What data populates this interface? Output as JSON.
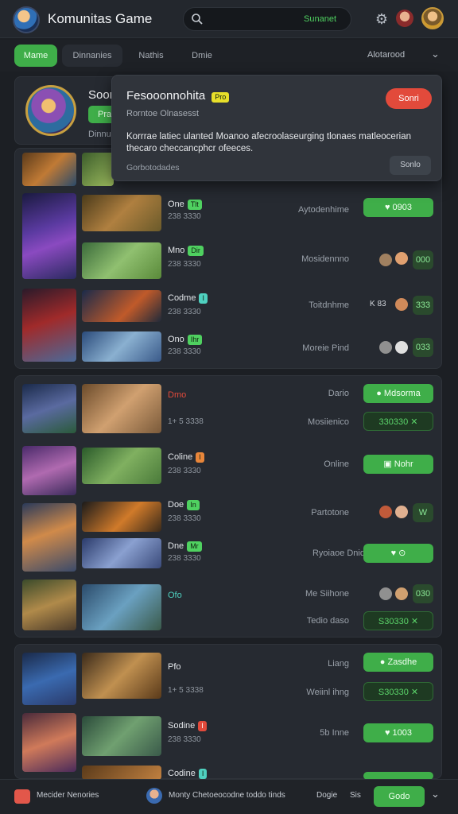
{
  "app": {
    "title": "Komunitas Game"
  },
  "search": {
    "value": "Sunanet"
  },
  "tabs": [
    {
      "label": "Mame",
      "active": true
    },
    {
      "label": "Dinnanies"
    },
    {
      "label": "Nathis"
    },
    {
      "label": "Dmie"
    }
  ],
  "sort": {
    "label": "Alotarood"
  },
  "profile": {
    "title": "Soor",
    "button": "Pra",
    "sub": "Dinnu"
  },
  "popup": {
    "title": "Fesooonnohita",
    "badge": "Pro",
    "subtitle": "Rorntoe Olnasesst",
    "description": "Korrrae latiec ulanted Moanoo afecroolaseurging tlonaes  matleocerian thecaro checcancphcr ofeeces.",
    "footer": "Gorbotodades",
    "primary": "Sonri",
    "secondary": "Sonlo"
  },
  "groups": [
    {
      "rows": [
        {
          "title": "One",
          "badge": "Tlt",
          "sub": "238 3330",
          "status": "Aytodenhime",
          "button": "0903",
          "style": "solid"
        },
        {
          "title": "Mno",
          "badge": "Dir",
          "sub": "238 3330",
          "status": "Mosidennno",
          "button": "000",
          "style": "small"
        },
        {
          "title": "Codme",
          "badge": "I",
          "sub": "238 3330",
          "status": "Toitdnhme",
          "button": "333",
          "style": "small",
          "extra": "K 83"
        },
        {
          "title": "Ono",
          "badge": "Ihr",
          "sub": "238 3330",
          "status": "Moreie Pind",
          "button": "033",
          "style": "small"
        }
      ]
    },
    {
      "rows": [
        {
          "title": "Dmo",
          "badge": "",
          "sub": "1+ 5 3338",
          "status": "Dario",
          "button": "Mdsorma",
          "style": "solid",
          "button2": "330330",
          "status2": "Mosiienico"
        },
        {
          "title": "Coline",
          "badge": "I",
          "sub": "238 3330",
          "status": "Online",
          "button": "Nohr",
          "style": "solid"
        },
        {
          "title": "Doe",
          "badge": "In",
          "sub": "238 3330",
          "status": "Partotone",
          "button": "W",
          "style": "small"
        },
        {
          "title": "Dne",
          "badge": "Mr",
          "sub": "238 3330",
          "status": "Ryoiaoe Dnid",
          "button": "0",
          "style": "solid"
        },
        {
          "title": "Ofo",
          "badge": "",
          "sub": "",
          "status": "Me Siihone",
          "button": "030",
          "style": "small",
          "button2": "S30330",
          "status2": "Tedio daso"
        }
      ]
    },
    {
      "rows": [
        {
          "title": "Pfo",
          "badge": "",
          "sub": "1+ 5 3338",
          "status": "Liang",
          "button": "Zasdhe",
          "style": "solid",
          "button2": "S30330",
          "status2": "Weiinl ihng"
        },
        {
          "title": "Sodine",
          "badge": "I",
          "sub": "238 3330",
          "status": "5b Inne",
          "button": "1003",
          "style": "solid"
        },
        {
          "title": "Codine",
          "badge": "I",
          "sub": "",
          "status": "",
          "button": "",
          "style": "solid"
        }
      ]
    }
  ],
  "bottom": {
    "left": "Mecider Nenories",
    "center": "Monty Chetoeocodne toddo tinds",
    "status": "Dogie",
    "count": "Sis",
    "button": "Godo"
  },
  "colors": {
    "accent": "#3fae49",
    "danger": "#e24a3b",
    "bg": "#1c1f24"
  }
}
